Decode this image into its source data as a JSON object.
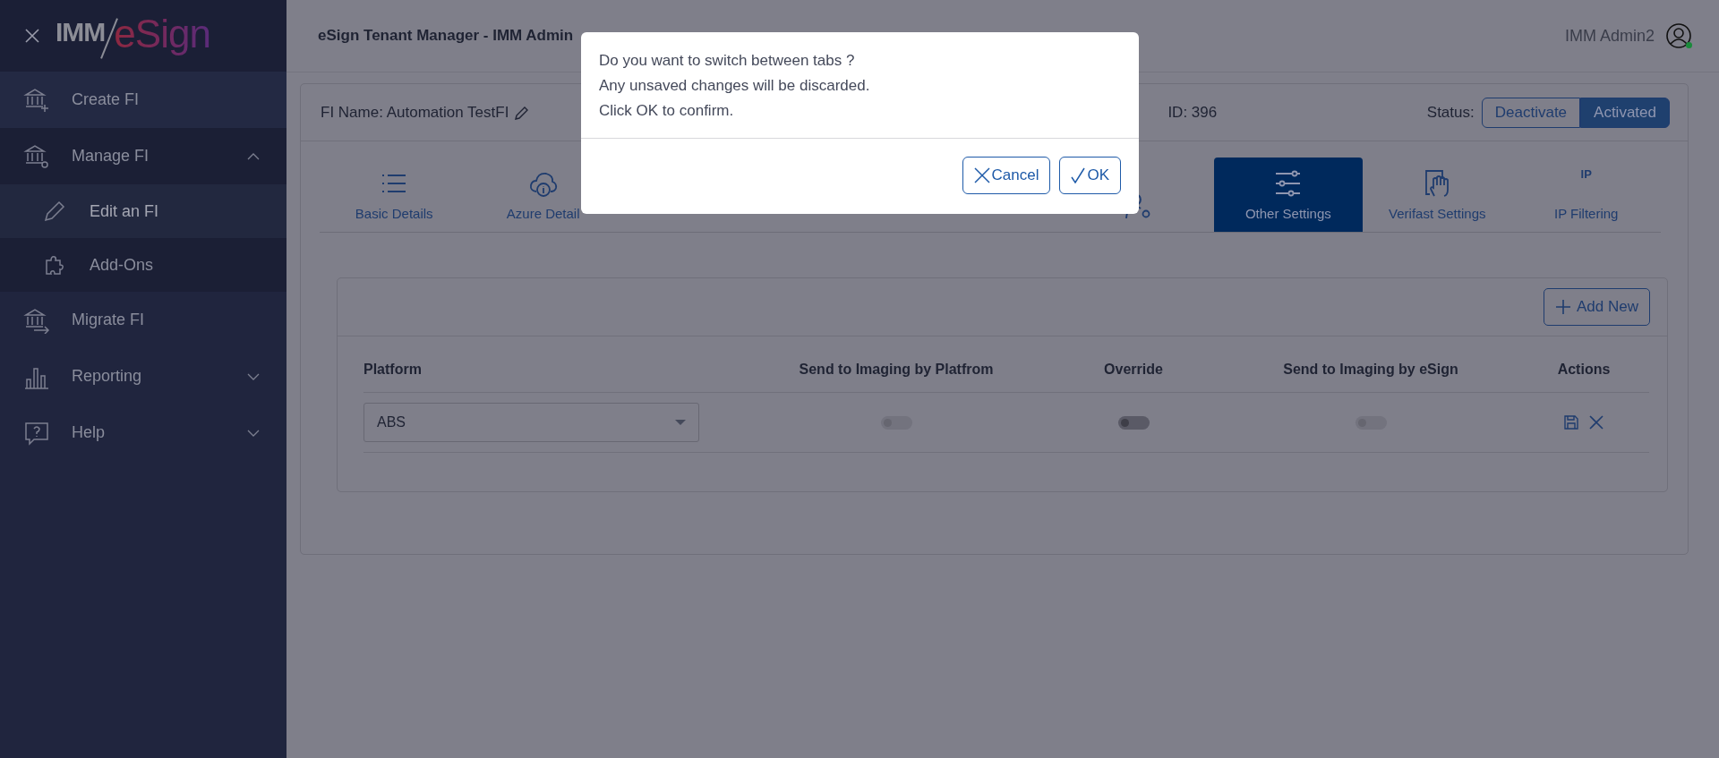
{
  "sidebar": {
    "logo": {
      "left": "IMM",
      "right": "eSign"
    },
    "items": [
      {
        "label": "Create FI",
        "selected": false
      },
      {
        "label": "Manage FI",
        "selected": false,
        "expanded": true,
        "children": [
          {
            "label": "Edit an FI",
            "selected": true
          },
          {
            "label": "Add-Ons",
            "selected": false
          }
        ]
      },
      {
        "label": "Migrate FI",
        "selected": false
      },
      {
        "label": "Reporting",
        "selected": false,
        "expanded": false
      },
      {
        "label": "Help",
        "selected": false,
        "expanded": false
      }
    ]
  },
  "header": {
    "title": "eSign Tenant Manager - IMM Admin",
    "user": "IMM Admin2",
    "online": true
  },
  "card": {
    "fi_name": "FI Name: Automation TestFI",
    "fi_id": "ID: 396",
    "status_label": "Status:",
    "status_buttons": [
      {
        "label": "Deactivate",
        "selected": false
      },
      {
        "label": "Activated",
        "selected": true
      }
    ],
    "tabs": [
      {
        "label": "Basic Details",
        "selected": false
      },
      {
        "label": "Azure Detail",
        "selected": false
      },
      {
        "selected": false
      },
      {
        "selected": false
      },
      {
        "selected": false
      },
      {
        "selected": false
      },
      {
        "label": "Other Settings",
        "selected": true
      },
      {
        "label": "Verifast Settings",
        "selected": false
      },
      {
        "label": "IP Filtering",
        "icon_text": "IP",
        "selected": false
      }
    ],
    "table": {
      "add_button": "Add New",
      "columns": [
        "Platform",
        "Send to Imaging by Platfrom",
        "Override",
        "Send to Imaging by eSign",
        "Actions"
      ],
      "rows": [
        {
          "platform": "ABS",
          "toggles": [
            {
              "on": false,
              "disabled": true
            },
            {
              "on": false,
              "disabled": false
            },
            {
              "on": false,
              "disabled": true
            }
          ]
        }
      ]
    }
  },
  "dialog": {
    "lines": [
      "Do you want to switch between tabs ?",
      "Any unsaved changes will be discarded.",
      "Click OK to confirm."
    ],
    "buttons": [
      {
        "label": "Cancel",
        "kind": "cancel"
      },
      {
        "label": "OK",
        "kind": "ok"
      }
    ]
  }
}
